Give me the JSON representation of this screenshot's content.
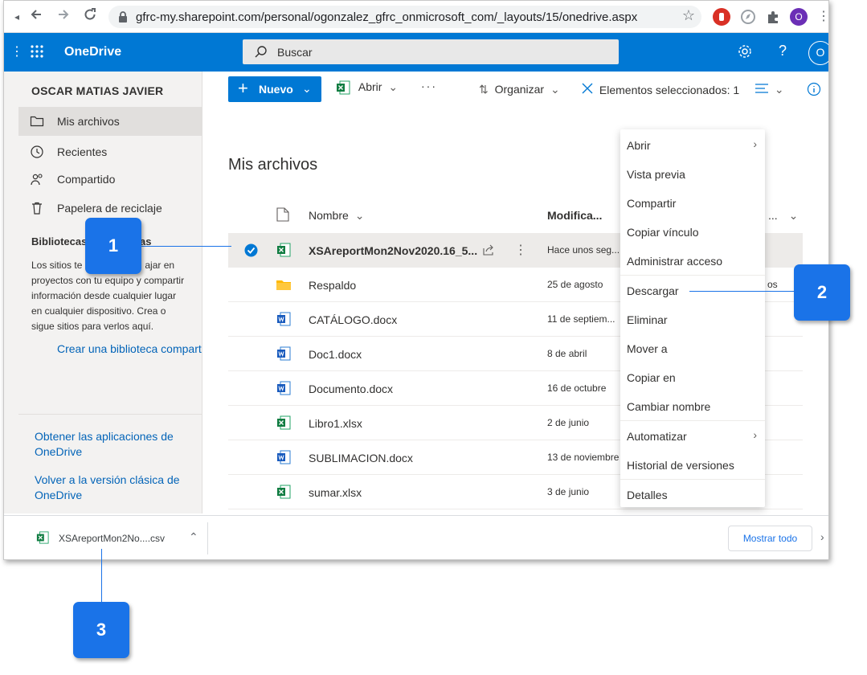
{
  "browser": {
    "url": "gfrc-my.sharepoint.com/personal/ogonzalez_gfrc_onmicrosoft_com/_layouts/15/onedrive.aspx",
    "profile_initial": "O"
  },
  "header": {
    "brand": "OneDrive",
    "search_placeholder": "Buscar",
    "avatar_initial": "O",
    "brand_color": "#0078d4"
  },
  "leftnav": {
    "user": "OSCAR MATIAS JAVIER",
    "items": [
      {
        "label": "Mis archivos",
        "icon": "folder-icon",
        "selected": true
      },
      {
        "label": "Recientes",
        "icon": "clock-icon"
      },
      {
        "label": "Compartido",
        "icon": "people-icon"
      },
      {
        "label": "Papelera de reciclaje",
        "icon": "recycle-bin-icon"
      }
    ],
    "libraries_title": "Bibliotecas",
    "libraries_title_tail": "ias",
    "libraries_desc": [
      "Los sitios te a",
      "ajar en",
      "proyectos con tu equipo y compartir",
      "información desde cualquier lugar",
      "en cualquier dispositivo. Crea o",
      "sigue sitios para verlos aquí."
    ],
    "create_library": "Crear una biblioteca compart",
    "get_apps": "Obtener las aplicaciones de OneDrive",
    "classic": "Volver a la versión clásica de OneDrive"
  },
  "cmdbar": {
    "new": "Nuevo",
    "open": "Abrir",
    "organize": "Organizar",
    "selected": "Elementos seleccionados: 1"
  },
  "main": {
    "title": "Mis archivos",
    "col_name": "Nombre",
    "col_modified": "Modifica...",
    "col_extra": "...",
    "files": [
      {
        "name": "XSAreportMon2Nov2020.16_5...",
        "modified": "Hace unos seg...",
        "type": "excel",
        "selected": true
      },
      {
        "name": "Respaldo",
        "modified": "25 de agosto",
        "type": "folder",
        "extra": "os"
      },
      {
        "name": "CATÁLOGO.docx",
        "modified": "11 de septiem...",
        "type": "word"
      },
      {
        "name": "Doc1.docx",
        "modified": "8 de abril",
        "type": "word"
      },
      {
        "name": "Documento.docx",
        "modified": "16 de octubre",
        "type": "word"
      },
      {
        "name": "Libro1.xlsx",
        "modified": "2 de junio",
        "type": "excel"
      },
      {
        "name": "SUBLIMACION.docx",
        "modified": "13 de noviembre",
        "type": "word"
      },
      {
        "name": "sumar.xlsx",
        "modified": "3 de junio",
        "type": "excel"
      }
    ]
  },
  "context_menu": {
    "items": [
      "Abrir",
      "Vista previa",
      "Compartir",
      "Copiar vínculo",
      "Administrar acceso",
      "Descargar",
      "Eliminar",
      "Mover a",
      "Copiar en",
      "Cambiar nombre",
      "Automatizar",
      "Historial de versiones",
      "Detalles"
    ]
  },
  "download_bar": {
    "file": "XSAreportMon2No....csv",
    "show_all": "Mostrar todo"
  },
  "callouts": {
    "one": "1",
    "two": "2",
    "three": "3",
    "color": "#1a73e8"
  }
}
